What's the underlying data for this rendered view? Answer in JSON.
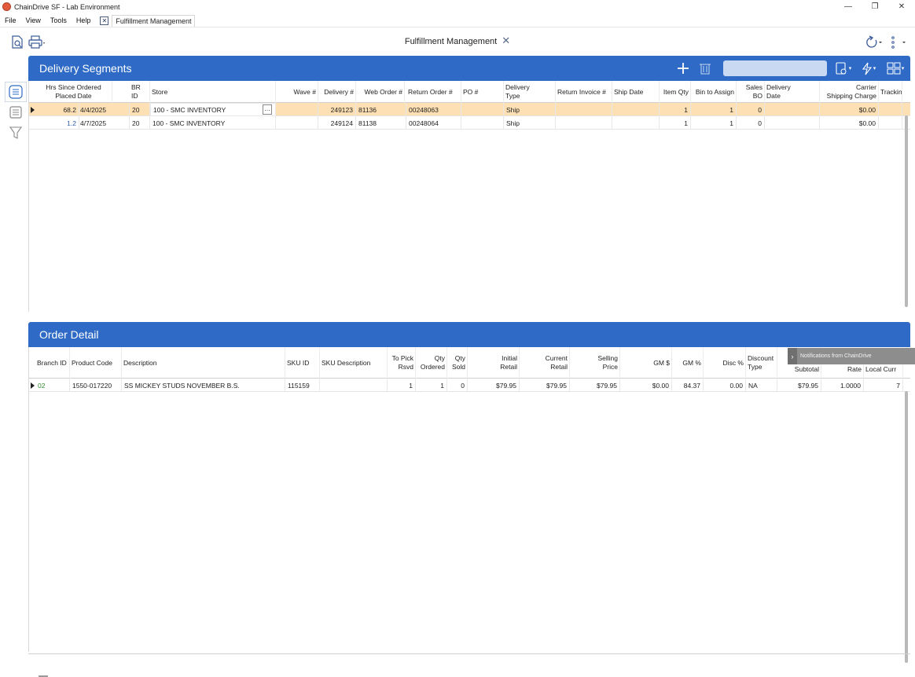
{
  "window": {
    "title": "ChainDrive SF - Lab Environment",
    "controls": {
      "minimize": "—",
      "restore": "❐",
      "close": "✕"
    }
  },
  "menu": {
    "items": [
      "File",
      "View",
      "Tools",
      "Help"
    ],
    "doc_tab": "Fulfillment Management"
  },
  "toolbar": {
    "page_title": "Fulfillment Management",
    "close_glyph": "✕"
  },
  "delivery_segments": {
    "title": "Delivery Segments",
    "search_placeholder": "",
    "columns": [
      {
        "label": "Hrs Since Ordered\nPlaced Date"
      },
      {
        "label": "BR\nID"
      },
      {
        "label": "Store"
      },
      {
        "label": "Wave #"
      },
      {
        "label": "Delivery #"
      },
      {
        "label": "Web Order #"
      },
      {
        "label": "Return Order #"
      },
      {
        "label": "PO #"
      },
      {
        "label": "Delivery\nType"
      },
      {
        "label": "Return Invoice #"
      },
      {
        "label": "Ship Date"
      },
      {
        "label": "Item Qty"
      },
      {
        "label": "Bin to Assign"
      },
      {
        "label": "Sales\nBO"
      },
      {
        "label": "Delivery\nDate"
      },
      {
        "label": "Carrier\nShipping Charge"
      },
      {
        "label": "Trackin"
      }
    ],
    "rows": [
      {
        "hrs": "68.2",
        "placed": "4/4/2025",
        "br": "20",
        "store": "100 - SMC INVENTORY",
        "wave": "",
        "delivery": "249123",
        "web_order": "81136",
        "return_order": "00248063",
        "po": "",
        "type": "Ship",
        "return_invoice": "",
        "ship_date": "",
        "item_qty": "1",
        "bin": "1",
        "sales_bo": "0",
        "delivery_date": "",
        "shipping": "$0.00",
        "tracking": "",
        "selected": true
      },
      {
        "hrs": "1.2",
        "placed": "4/7/2025",
        "br": "20",
        "store": "100 - SMC INVENTORY",
        "wave": "",
        "delivery": "249124",
        "web_order": "81138",
        "return_order": "00248064",
        "po": "",
        "type": "Ship",
        "return_invoice": "",
        "ship_date": "",
        "item_qty": "1",
        "bin": "1",
        "sales_bo": "0",
        "delivery_date": "",
        "shipping": "$0.00",
        "tracking": "",
        "selected": false
      }
    ]
  },
  "order_detail": {
    "title": "Order Detail",
    "columns": [
      {
        "label": "Branch ID"
      },
      {
        "label": "Product Code"
      },
      {
        "label": "Description"
      },
      {
        "label": "SKU ID"
      },
      {
        "label": "SKU Description"
      },
      {
        "label": "To Pick\nRsvd"
      },
      {
        "label": "Qty\nOrdered"
      },
      {
        "label": "Qty\nSold"
      },
      {
        "label": "Initial\nRetail"
      },
      {
        "label": "Current\nRetail"
      },
      {
        "label": "Selling\nPrice"
      },
      {
        "label": "GM $"
      },
      {
        "label": "GM %"
      },
      {
        "label": "Disc %"
      },
      {
        "label": "Discount\nType"
      },
      {
        "label": "Subtotal"
      },
      {
        "label": "Rate"
      },
      {
        "label": "Local Curr"
      }
    ],
    "rows": [
      {
        "branch": "02",
        "product_code": "1550-017220",
        "description": "SS MICKEY STUDS NOVEMBER B.S.",
        "sku_id": "115159",
        "sku_desc": "",
        "to_pick": "1",
        "qty_ordered": "1",
        "qty_sold": "0",
        "initial_retail": "$79.95",
        "current_retail": "$79.95",
        "selling_price": "$79.95",
        "gm_dollar": "$0.00",
        "gm_pct": "84.37",
        "disc_pct": "0.00",
        "discount_type": "NA",
        "subtotal": "$79.95",
        "rate": "1.0000",
        "local_curr": "7"
      }
    ],
    "tooltip": "Notifications from ChainDrive"
  },
  "colors": {
    "header_blue": "#2f6bc6",
    "selected_row": "#fde0b3",
    "branch_green": "#2e8b2e"
  }
}
